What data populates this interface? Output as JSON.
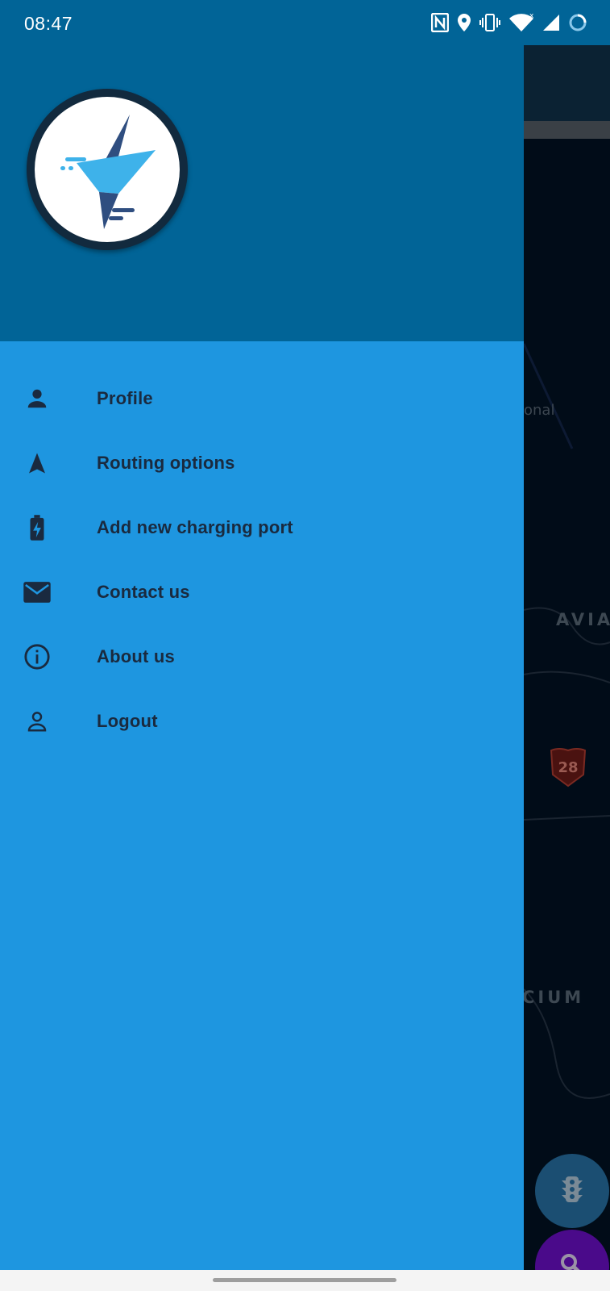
{
  "status_bar": {
    "time": "08:47",
    "icons": [
      "nfc-icon",
      "location-icon",
      "vibrate-icon",
      "wifi-icon",
      "signal-icon",
      "loading-icon"
    ]
  },
  "map": {
    "labels": [
      "onal",
      "AVIA",
      "CIUM"
    ],
    "route_shield": "28",
    "fabs": [
      "traffic-light-icon",
      "search-icon"
    ]
  },
  "drawer": {
    "header": {
      "logo": "app-logo"
    },
    "menu": [
      {
        "label": "Profile",
        "icon": "person-icon"
      },
      {
        "label": "Routing options",
        "icon": "navigation-arrow-icon"
      },
      {
        "label": "Add new charging port",
        "icon": "battery-charging-icon"
      },
      {
        "label": "Contact us",
        "icon": "mail-icon"
      },
      {
        "label": "About us",
        "icon": "info-icon"
      },
      {
        "label": "Logout",
        "icon": "person-outline-icon"
      }
    ]
  },
  "colors": {
    "header": "#016497",
    "drawer": "#1e96e0",
    "menu_text": "#1a2a3f"
  }
}
